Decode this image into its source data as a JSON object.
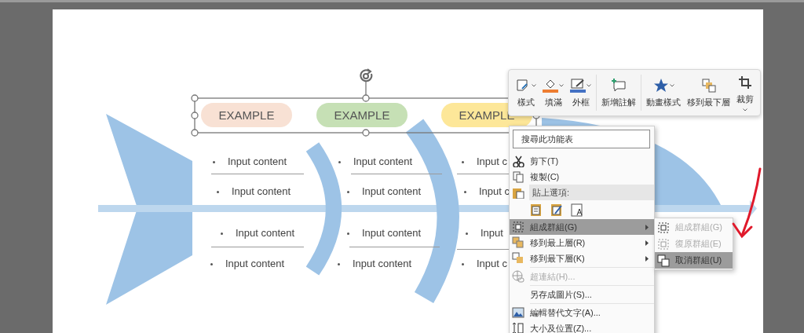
{
  "slide": {
    "labels": [
      {
        "text": "EXAMPLE",
        "color": "#f8e1d4"
      },
      {
        "text": "EXAMPLE",
        "color": "#c6e0b5"
      },
      {
        "text": "EXAMPLE",
        "color": "#fde799"
      }
    ],
    "columns": [
      {
        "items": [
          "Input content",
          "Input content",
          "Input content",
          "Input content"
        ]
      },
      {
        "items": [
          "Input content",
          "Input content",
          "Input content",
          "Input content"
        ]
      },
      {
        "items": [
          "Input c",
          "Input c",
          "Input",
          "Input c"
        ]
      }
    ]
  },
  "toolbar": {
    "buttons": [
      {
        "label": "樣式",
        "dropdown": true
      },
      {
        "label": "填滿",
        "dropdown": true
      },
      {
        "label": "外框",
        "dropdown": true
      },
      {
        "label": "新增註解",
        "dropdown": false
      },
      {
        "label": "動畫樣式",
        "dropdown": true
      },
      {
        "label": "移到最下層",
        "dropdown": false
      },
      {
        "label": "裁剪",
        "dropdown": true
      }
    ]
  },
  "context_menu": {
    "search": {
      "placeholder": "搜尋此功能表"
    },
    "items": [
      {
        "kind": "item",
        "label": "剪下(T)",
        "selected": false,
        "disabled": false,
        "submenu": false
      },
      {
        "kind": "item",
        "label": "複製(C)",
        "selected": false,
        "disabled": false,
        "submenu": false
      },
      {
        "kind": "header",
        "label": "貼上選項:"
      },
      {
        "kind": "paste_options"
      },
      {
        "kind": "item",
        "label": "組成群組(G)",
        "selected": true,
        "disabled": false,
        "submenu": true
      },
      {
        "kind": "item",
        "label": "移到最上層(R)",
        "selected": false,
        "disabled": false,
        "submenu": true
      },
      {
        "kind": "item",
        "label": "移到最下層(K)",
        "selected": false,
        "disabled": false,
        "submenu": true
      },
      {
        "kind": "item",
        "label": "超連結(H)...",
        "selected": false,
        "disabled": true,
        "submenu": false
      },
      {
        "kind": "item",
        "label": "另存成圖片(S)...",
        "selected": false,
        "disabled": false,
        "submenu": false
      },
      {
        "kind": "item",
        "label": "編輯替代文字(A)...",
        "selected": false,
        "disabled": false,
        "submenu": false
      },
      {
        "kind": "item",
        "label": "大小及位置(Z)...",
        "selected": false,
        "disabled": false,
        "submenu": false
      }
    ]
  },
  "submenu": {
    "items": [
      {
        "label": "組成群組(G)",
        "selected": false,
        "disabled": true
      },
      {
        "label": "復原群組(E)",
        "selected": false,
        "disabled": true
      },
      {
        "label": "取消群組(U)",
        "selected": true,
        "disabled": false
      }
    ]
  }
}
